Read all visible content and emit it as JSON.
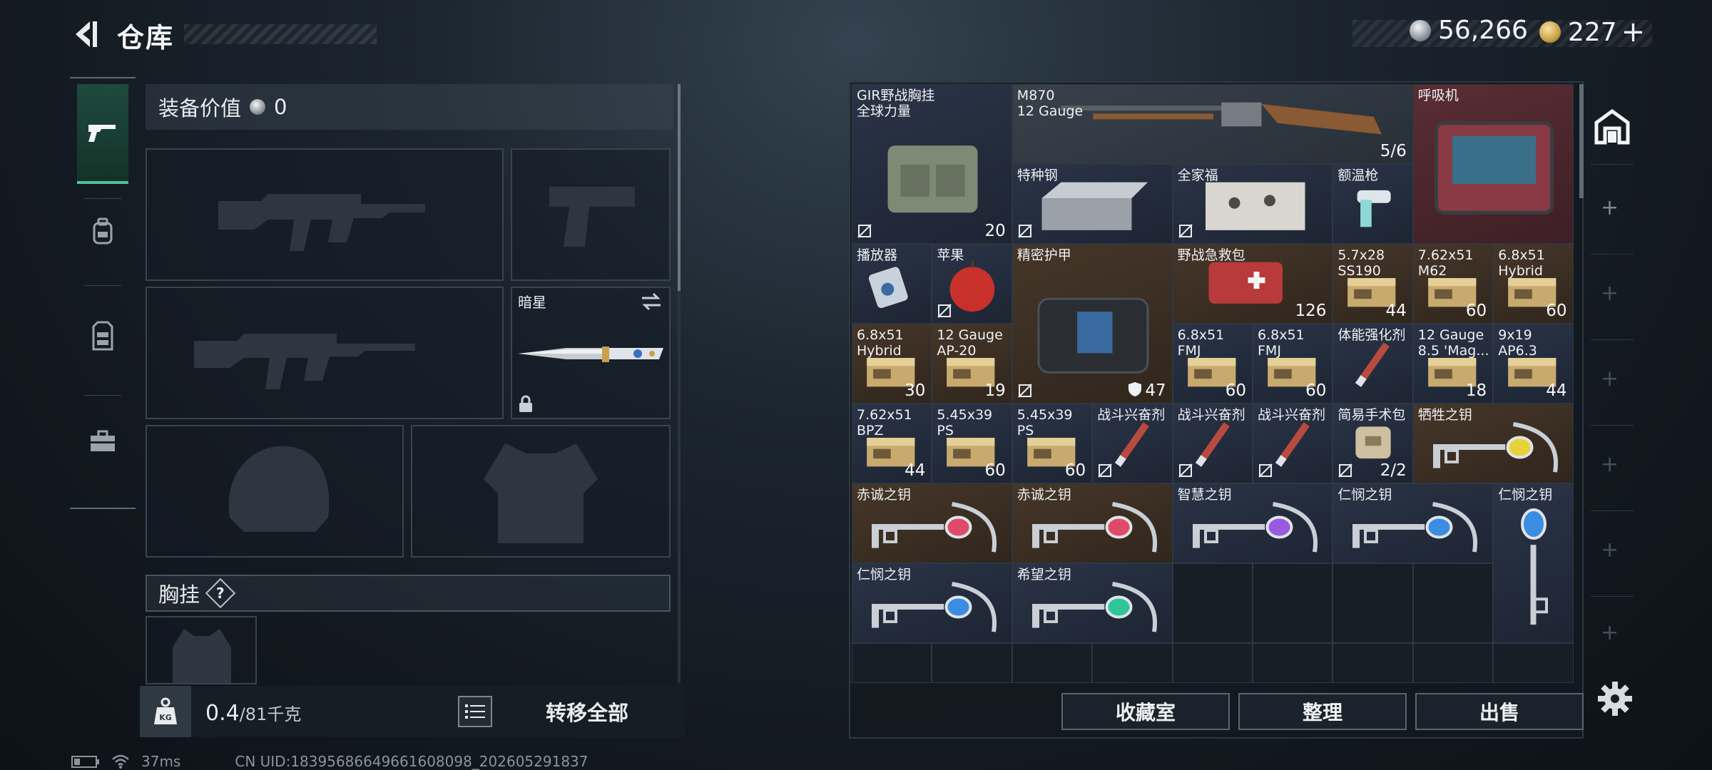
{
  "header": {
    "title": "仓库",
    "back_icon": "back-arrow-icon"
  },
  "currency": {
    "silver": "56,266",
    "gold": "227",
    "add_label": "+"
  },
  "tabs": [
    {
      "icon": "gun-icon",
      "active": true
    },
    {
      "icon": "backpack-icon",
      "active": false
    },
    {
      "icon": "vest-icon",
      "active": false
    },
    {
      "icon": "briefcase-icon",
      "active": false
    }
  ],
  "loadout": {
    "equip_value_label": "装备价值",
    "equip_value": "0",
    "melee_name": "暗星",
    "vest_label": "胸挂",
    "help_mark": "?"
  },
  "bottom_left": {
    "weight_current": "0.4",
    "weight_max": "/81千克",
    "weight_icon_text": "KG",
    "transfer_label": "转移全部"
  },
  "stash": {
    "items": [
      {
        "name": "GIR野战胸挂\n全球力量",
        "count": "20",
        "bg": "blue"
      },
      {
        "name": "M870\n12 Gauge",
        "count": "5/6",
        "bg": "grey"
      },
      {
        "name": "呼吸机",
        "count": "",
        "bg": "red"
      },
      {
        "name": "特种钢",
        "count": "",
        "bg": "blue"
      },
      {
        "name": "全家福",
        "count": "",
        "bg": "blue"
      },
      {
        "name": "额温枪",
        "count": "",
        "bg": "blue"
      },
      {
        "name": "播放器",
        "count": "",
        "bg": "blue"
      },
      {
        "name": "苹果",
        "count": "",
        "bg": "blue"
      },
      {
        "name": "精密护甲",
        "count": "",
        "bg": "brown"
      },
      {
        "name": "野战急救包",
        "count": "126",
        "bg": "brown"
      },
      {
        "name": "5.7x28\nSS190",
        "count": "44",
        "bg": "brown"
      },
      {
        "name": "7.62x51\nM62",
        "count": "60",
        "bg": "brown"
      },
      {
        "name": "6.8x51\nHybrid",
        "count": "60",
        "bg": "brown"
      },
      {
        "name": "6.8x51\nHybrid",
        "count": "30",
        "bg": "brown"
      },
      {
        "name": "12 Gauge\nAP-20",
        "count": "19",
        "bg": "brown"
      },
      {
        "name": "",
        "count": "47",
        "bg": "brown"
      },
      {
        "name": "6.8x51\nFMJ",
        "count": "60",
        "bg": "blue"
      },
      {
        "name": "6.8x51\nFMJ",
        "count": "60",
        "bg": "blue"
      },
      {
        "name": "体能强化剂",
        "count": "",
        "bg": "blue"
      },
      {
        "name": "12 Gauge\n8.5 'Mag...",
        "count": "18",
        "bg": "blue"
      },
      {
        "name": "9x19\nAP6.3",
        "count": "44",
        "bg": "blue"
      },
      {
        "name": "7.62x51\nBPZ",
        "count": "44",
        "bg": "blue"
      },
      {
        "name": "5.45x39\nPS",
        "count": "60",
        "bg": "blue"
      },
      {
        "name": "5.45x39\nPS",
        "count": "60",
        "bg": "blue"
      },
      {
        "name": "战斗兴奋剂",
        "count": "",
        "bg": "blue"
      },
      {
        "name": "战斗兴奋剂",
        "count": "",
        "bg": "blue"
      },
      {
        "name": "战斗兴奋剂",
        "count": "",
        "bg": "blue"
      },
      {
        "name": "简易手术包",
        "count": "2/2",
        "bg": "blue"
      },
      {
        "name": "牺牲之钥",
        "count": "",
        "bg": "brown"
      },
      {
        "name": "赤诚之钥",
        "count": "",
        "bg": "brown"
      },
      {
        "name": "赤诚之钥",
        "count": "",
        "bg": "brown"
      },
      {
        "name": "智慧之钥",
        "count": "",
        "bg": "blue"
      },
      {
        "name": "仁悯之钥",
        "count": "",
        "bg": "blue"
      },
      {
        "name": "仁悯之钥",
        "count": "",
        "bg": "blue"
      },
      {
        "name": "仁悯之钥",
        "count": "",
        "bg": "blue"
      },
      {
        "name": "希望之钥",
        "count": "",
        "bg": "blue"
      }
    ],
    "buttons": {
      "collection": "收藏室",
      "organize": "整理",
      "sell": "出售"
    }
  },
  "status": {
    "ping": "37ms",
    "uid": "CN UID:18395686649661608098_202605291837"
  },
  "colors": {
    "accent_green": "#4fc39a",
    "gem_red": "#e04a6a",
    "gem_blue": "#3a8de0",
    "gem_purple": "#9a5ae0",
    "gem_green": "#2fc59a",
    "gem_yellow": "#e8d23a"
  }
}
